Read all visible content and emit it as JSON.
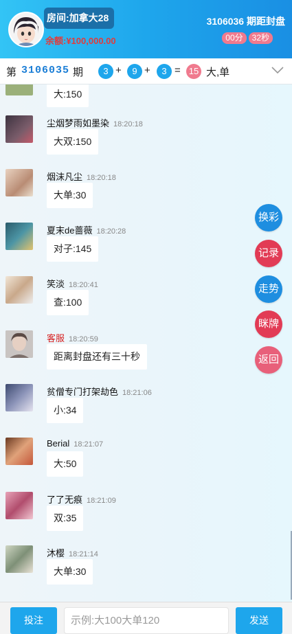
{
  "header": {
    "room_label": "房间:加拿大28",
    "balance": "余额:¥100,000.00",
    "period_close": "3106036 期距封盘",
    "countdown_minutes": "00分",
    "countdown_seconds": "32秒"
  },
  "result_bar": {
    "prefix": "第",
    "period": "3106035",
    "suffix": "期",
    "balls": [
      "3",
      "9",
      "3",
      "15"
    ],
    "ops": [
      "+",
      "+",
      "="
    ],
    "result": "大,单"
  },
  "messages": [
    {
      "name": "",
      "time": "",
      "text": "大:150",
      "avatar_color": "#9bb07a"
    },
    {
      "name": "尘烟梦雨如墨染",
      "time": "18:20:18",
      "text": "大双:150",
      "avatar_color": "#5a4b55"
    },
    {
      "name": "烟沫凡尘",
      "time": "18:20:18",
      "text": "大单:30",
      "avatar_color": "#c8a48a"
    },
    {
      "name": "夏末de蔷薇",
      "time": "18:20:28",
      "text": "对子:145",
      "avatar_color": "#3a7a8a"
    },
    {
      "name": "笑淡",
      "time": "18:20:41",
      "text": "查:100",
      "avatar_color": "#d9c1a8"
    },
    {
      "name": "客服",
      "time": "18:20:59",
      "text": "距离封盘还有三十秒",
      "avatar_color": "#8a6b5e",
      "highlight": true
    },
    {
      "name": "贫僧专门打架劫色",
      "time": "18:21:06",
      "text": "小:34",
      "avatar_color": "#5b6a8c"
    },
    {
      "name": "Berial",
      "time": "18:21:07",
      "text": "大:50",
      "avatar_color": "#b86a3a"
    },
    {
      "name": "了了无痕",
      "time": "18:21:09",
      "text": "双:35",
      "avatar_color": "#b5607a"
    },
    {
      "name": "沐樱",
      "time": "18:21:14",
      "text": "大单:30",
      "avatar_color": "#8aa082"
    }
  ],
  "side_buttons": [
    {
      "label": "换彩",
      "color": "#1e8ee0"
    },
    {
      "label": "记录",
      "color": "#e23b55"
    },
    {
      "label": "走势",
      "color": "#1e8ee0"
    },
    {
      "label": "眯牌",
      "color": "#e23b55"
    },
    {
      "label": "返回",
      "color": "#e8607a"
    }
  ],
  "footer": {
    "bet_label": "投注",
    "input_placeholder": "示例:大100大单120",
    "send_label": "发送"
  },
  "colors": {
    "primary": "#1ea6ec",
    "danger": "#e23b3b",
    "pill_pink": "#f07a8e"
  }
}
